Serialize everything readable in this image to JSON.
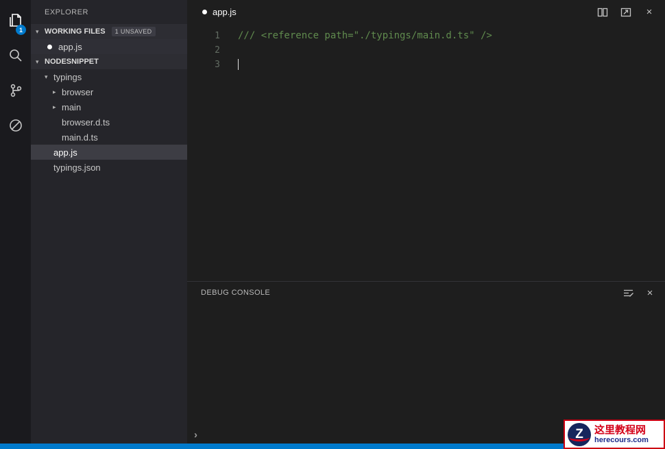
{
  "colors": {
    "accent": "#007acc",
    "editor_bg": "#1e1e1e",
    "sidebar_bg": "#25252a",
    "activitybar_bg": "#1a1a1e",
    "comment_green": "#608b4e",
    "selection_bg": "#3d3d44"
  },
  "activity_bar": {
    "badge": "1",
    "items": [
      "explorer",
      "search",
      "git",
      "debug"
    ]
  },
  "sidebar": {
    "title": "EXPLORER",
    "expanded_twisty": "▾",
    "collapsed_twisty": "▸",
    "working_files": {
      "label": "WORKING FILES",
      "badge": "1 UNSAVED",
      "file": "app.js"
    },
    "project_label": "NODESNIPPET",
    "tree": [
      {
        "label": "typings",
        "twisty": "▾"
      },
      {
        "label": "browser",
        "twisty": "▸"
      },
      {
        "label": "main",
        "twisty": "▸"
      },
      {
        "label": "browser.d.ts",
        "twisty": ""
      },
      {
        "label": "main.d.ts",
        "twisty": ""
      },
      {
        "label": "app.js",
        "twisty": ""
      },
      {
        "label": "typings.json",
        "twisty": ""
      }
    ]
  },
  "editor": {
    "tab_label": "app.js",
    "line_numbers": [
      "1",
      "2",
      "3"
    ],
    "code_line_1": "/// <reference path=\"./typings/main.d.ts\" />",
    "close_glyph": "×"
  },
  "panel": {
    "title": "DEBUG CONSOLE",
    "input_chevron": "›",
    "close_glyph": "×"
  },
  "watermark": {
    "title": "这里教程网",
    "subtitle": "herecours.com",
    "logo_letter": "Z"
  }
}
